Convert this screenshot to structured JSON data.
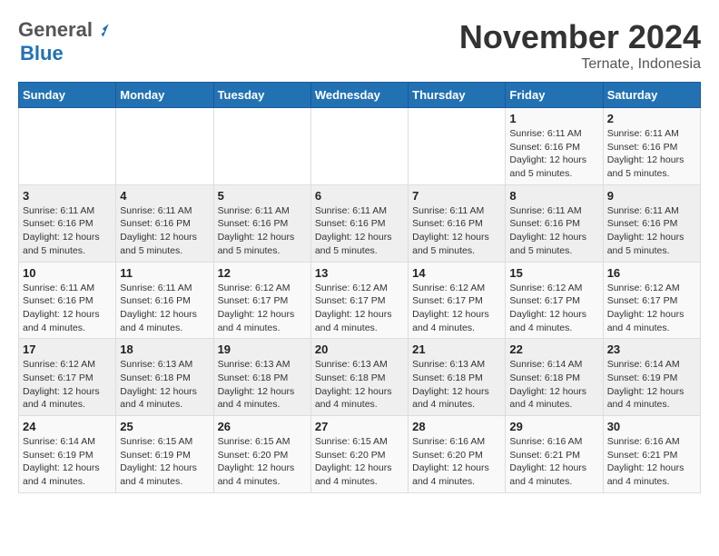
{
  "logo": {
    "general": "General",
    "blue": "Blue"
  },
  "header": {
    "month": "November 2024",
    "location": "Ternate, Indonesia"
  },
  "weekdays": [
    "Sunday",
    "Monday",
    "Tuesday",
    "Wednesday",
    "Thursday",
    "Friday",
    "Saturday"
  ],
  "weeks": [
    [
      {
        "day": "",
        "info": ""
      },
      {
        "day": "",
        "info": ""
      },
      {
        "day": "",
        "info": ""
      },
      {
        "day": "",
        "info": ""
      },
      {
        "day": "",
        "info": ""
      },
      {
        "day": "1",
        "info": "Sunrise: 6:11 AM\nSunset: 6:16 PM\nDaylight: 12 hours and 5 minutes."
      },
      {
        "day": "2",
        "info": "Sunrise: 6:11 AM\nSunset: 6:16 PM\nDaylight: 12 hours and 5 minutes."
      }
    ],
    [
      {
        "day": "3",
        "info": "Sunrise: 6:11 AM\nSunset: 6:16 PM\nDaylight: 12 hours and 5 minutes."
      },
      {
        "day": "4",
        "info": "Sunrise: 6:11 AM\nSunset: 6:16 PM\nDaylight: 12 hours and 5 minutes."
      },
      {
        "day": "5",
        "info": "Sunrise: 6:11 AM\nSunset: 6:16 PM\nDaylight: 12 hours and 5 minutes."
      },
      {
        "day": "6",
        "info": "Sunrise: 6:11 AM\nSunset: 6:16 PM\nDaylight: 12 hours and 5 minutes."
      },
      {
        "day": "7",
        "info": "Sunrise: 6:11 AM\nSunset: 6:16 PM\nDaylight: 12 hours and 5 minutes."
      },
      {
        "day": "8",
        "info": "Sunrise: 6:11 AM\nSunset: 6:16 PM\nDaylight: 12 hours and 5 minutes."
      },
      {
        "day": "9",
        "info": "Sunrise: 6:11 AM\nSunset: 6:16 PM\nDaylight: 12 hours and 5 minutes."
      }
    ],
    [
      {
        "day": "10",
        "info": "Sunrise: 6:11 AM\nSunset: 6:16 PM\nDaylight: 12 hours and 4 minutes."
      },
      {
        "day": "11",
        "info": "Sunrise: 6:11 AM\nSunset: 6:16 PM\nDaylight: 12 hours and 4 minutes."
      },
      {
        "day": "12",
        "info": "Sunrise: 6:12 AM\nSunset: 6:17 PM\nDaylight: 12 hours and 4 minutes."
      },
      {
        "day": "13",
        "info": "Sunrise: 6:12 AM\nSunset: 6:17 PM\nDaylight: 12 hours and 4 minutes."
      },
      {
        "day": "14",
        "info": "Sunrise: 6:12 AM\nSunset: 6:17 PM\nDaylight: 12 hours and 4 minutes."
      },
      {
        "day": "15",
        "info": "Sunrise: 6:12 AM\nSunset: 6:17 PM\nDaylight: 12 hours and 4 minutes."
      },
      {
        "day": "16",
        "info": "Sunrise: 6:12 AM\nSunset: 6:17 PM\nDaylight: 12 hours and 4 minutes."
      }
    ],
    [
      {
        "day": "17",
        "info": "Sunrise: 6:12 AM\nSunset: 6:17 PM\nDaylight: 12 hours and 4 minutes."
      },
      {
        "day": "18",
        "info": "Sunrise: 6:13 AM\nSunset: 6:18 PM\nDaylight: 12 hours and 4 minutes."
      },
      {
        "day": "19",
        "info": "Sunrise: 6:13 AM\nSunset: 6:18 PM\nDaylight: 12 hours and 4 minutes."
      },
      {
        "day": "20",
        "info": "Sunrise: 6:13 AM\nSunset: 6:18 PM\nDaylight: 12 hours and 4 minutes."
      },
      {
        "day": "21",
        "info": "Sunrise: 6:13 AM\nSunset: 6:18 PM\nDaylight: 12 hours and 4 minutes."
      },
      {
        "day": "22",
        "info": "Sunrise: 6:14 AM\nSunset: 6:18 PM\nDaylight: 12 hours and 4 minutes."
      },
      {
        "day": "23",
        "info": "Sunrise: 6:14 AM\nSunset: 6:19 PM\nDaylight: 12 hours and 4 minutes."
      }
    ],
    [
      {
        "day": "24",
        "info": "Sunrise: 6:14 AM\nSunset: 6:19 PM\nDaylight: 12 hours and 4 minutes."
      },
      {
        "day": "25",
        "info": "Sunrise: 6:15 AM\nSunset: 6:19 PM\nDaylight: 12 hours and 4 minutes."
      },
      {
        "day": "26",
        "info": "Sunrise: 6:15 AM\nSunset: 6:20 PM\nDaylight: 12 hours and 4 minutes."
      },
      {
        "day": "27",
        "info": "Sunrise: 6:15 AM\nSunset: 6:20 PM\nDaylight: 12 hours and 4 minutes."
      },
      {
        "day": "28",
        "info": "Sunrise: 6:16 AM\nSunset: 6:20 PM\nDaylight: 12 hours and 4 minutes."
      },
      {
        "day": "29",
        "info": "Sunrise: 6:16 AM\nSunset: 6:21 PM\nDaylight: 12 hours and 4 minutes."
      },
      {
        "day": "30",
        "info": "Sunrise: 6:16 AM\nSunset: 6:21 PM\nDaylight: 12 hours and 4 minutes."
      }
    ]
  ]
}
